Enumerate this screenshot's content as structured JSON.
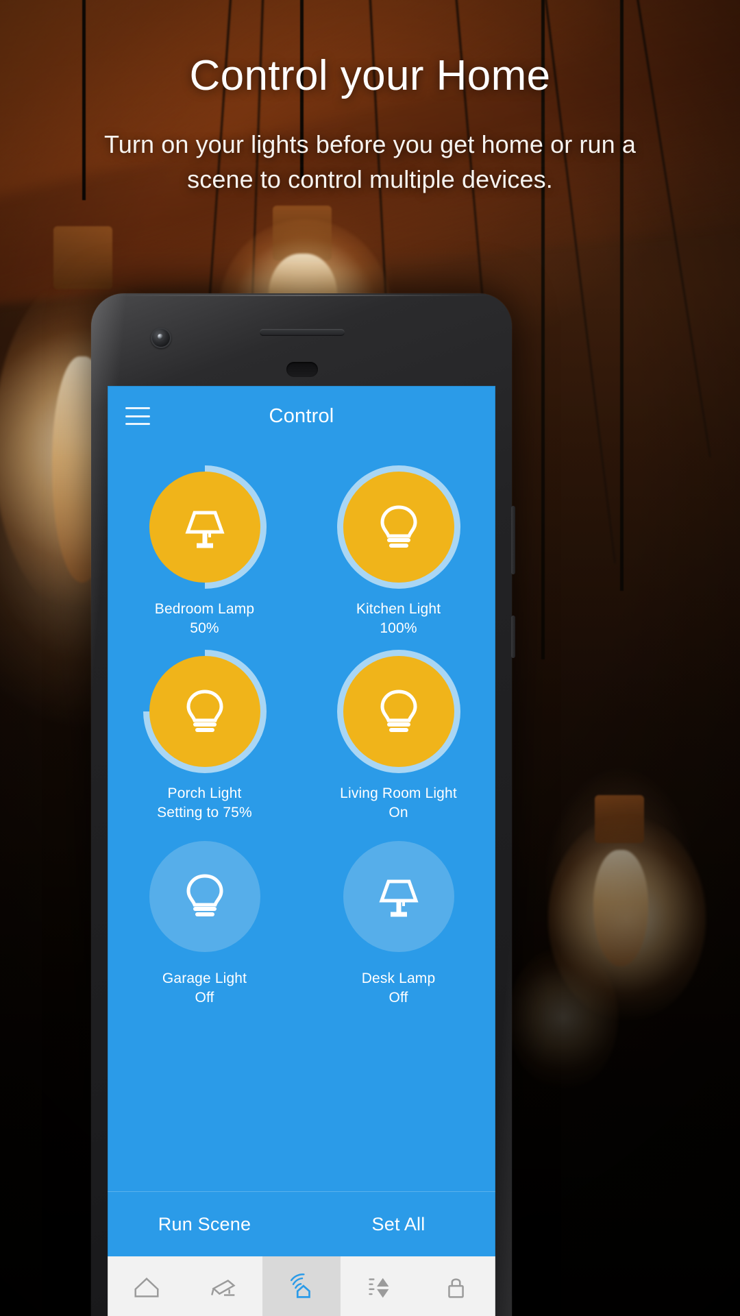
{
  "hero": {
    "title": "Control your Home",
    "subtitle": "Turn on your lights before you get home or run a scene to control multiple devices."
  },
  "colors": {
    "app_blue": "#2b9be8",
    "tile_on": "#f0b41a",
    "tile_off": "#56aeea",
    "ring_track": "#a9d6f4",
    "nav_active": "#2b9be8",
    "nav_inactive": "#9b9b9b"
  },
  "phone": {
    "camera_icon": "front-camera-icon",
    "speaker_icon": "speaker-grille-icon",
    "earpiece_icon": "earpiece-icon"
  },
  "app": {
    "menu_icon": "hamburger-menu-icon",
    "title": "Control",
    "devices": [
      {
        "name": "Bedroom Lamp",
        "state": "50%",
        "icon": "lamp-icon",
        "on": true,
        "progress": 50
      },
      {
        "name": "Kitchen Light",
        "state": "100%",
        "icon": "bulb-icon",
        "on": true,
        "progress": 100
      },
      {
        "name": "Porch Light",
        "state": "Setting to 75%",
        "icon": "bulb-icon",
        "on": true,
        "progress": 75
      },
      {
        "name": "Living Room Light",
        "state": "On",
        "icon": "bulb-icon",
        "on": true,
        "progress": 100
      },
      {
        "name": "Garage Light",
        "state": "Off",
        "icon": "bulb-icon",
        "on": false,
        "progress": 0
      },
      {
        "name": "Desk Lamp",
        "state": "Off",
        "icon": "lamp-icon",
        "on": false,
        "progress": 0
      }
    ],
    "actions": {
      "run_scene": "Run Scene",
      "set_all": "Set All"
    },
    "bottom_nav": [
      {
        "icon": "home-icon",
        "active": false
      },
      {
        "icon": "camera-icon",
        "active": false
      },
      {
        "icon": "wifi-home-icon",
        "active": true
      },
      {
        "icon": "levels-icon",
        "active": false
      },
      {
        "icon": "lock-icon",
        "active": false
      }
    ]
  }
}
